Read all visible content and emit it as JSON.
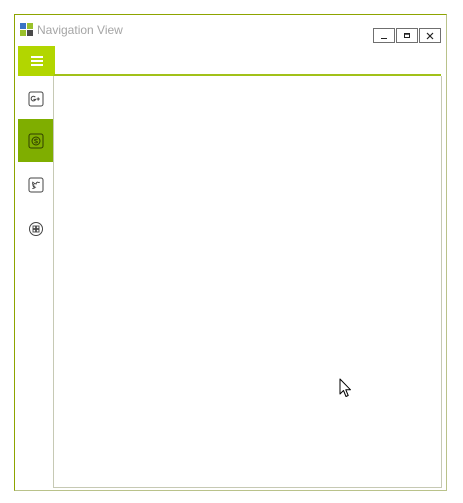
{
  "window": {
    "title": "Navigation View"
  },
  "nav": {
    "items": [
      {
        "icon": "google-plus-icon",
        "selected": false
      },
      {
        "icon": "skype-icon",
        "selected": true
      },
      {
        "icon": "twitter-icon",
        "selected": false
      },
      {
        "icon": "windows-icon",
        "selected": false
      }
    ]
  },
  "colors": {
    "accent": "#b2d600",
    "selected": "#7fae00",
    "underline": "#a1c119",
    "border": "#8da400"
  }
}
